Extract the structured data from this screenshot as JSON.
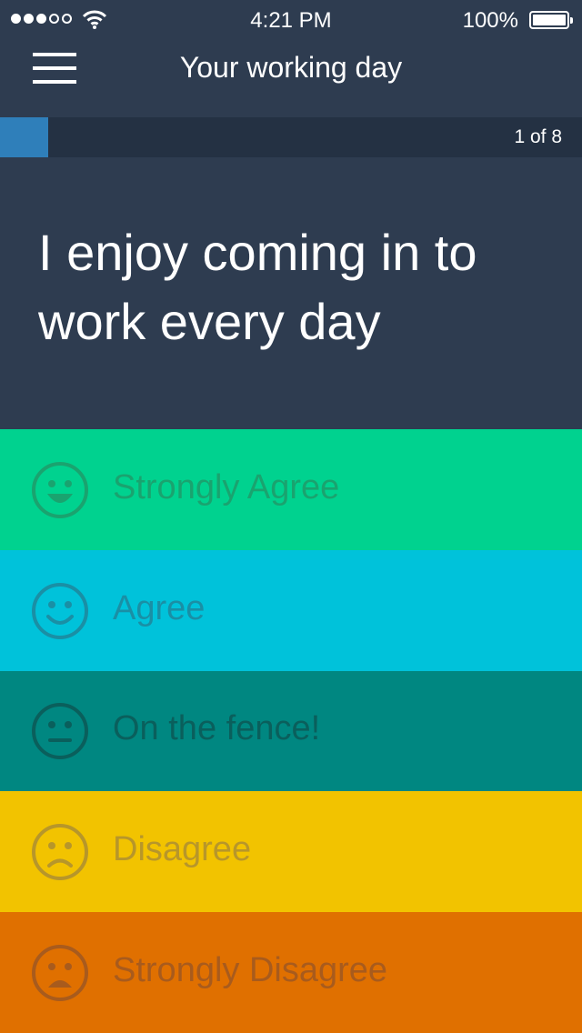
{
  "status_bar": {
    "time": "4:21 PM",
    "battery_percent": "100%",
    "signal_bars_filled": 3,
    "signal_bars_total": 5
  },
  "nav": {
    "title": "Your working day",
    "menu_icon": "hamburger-menu-icon"
  },
  "progress": {
    "text": "1 of 8",
    "current": 1,
    "total": 8
  },
  "question": {
    "text": "I enjoy coming in to work every day"
  },
  "answers": [
    {
      "label": "Strongly Agree",
      "icon": "very-happy-face-icon",
      "bg": "#00d28f",
      "fg": "#1aa36f"
    },
    {
      "label": "Agree",
      "icon": "happy-face-icon",
      "bg": "#00c2da",
      "fg": "#1a8fa5"
    },
    {
      "label": "On the fence!",
      "icon": "neutral-face-icon",
      "bg": "#008781",
      "fg": "#0a5f5c"
    },
    {
      "label": "Disagree",
      "icon": "sad-face-icon",
      "bg": "#f2c300",
      "fg": "#b7962a"
    },
    {
      "label": "Strongly Disagree",
      "icon": "very-sad-face-icon",
      "bg": "#e07000",
      "fg": "#a85b1d"
    }
  ],
  "colors": {
    "header_bg": "#2e3c50",
    "progress_track": "#243143",
    "progress_fill": "#2f7fba"
  }
}
